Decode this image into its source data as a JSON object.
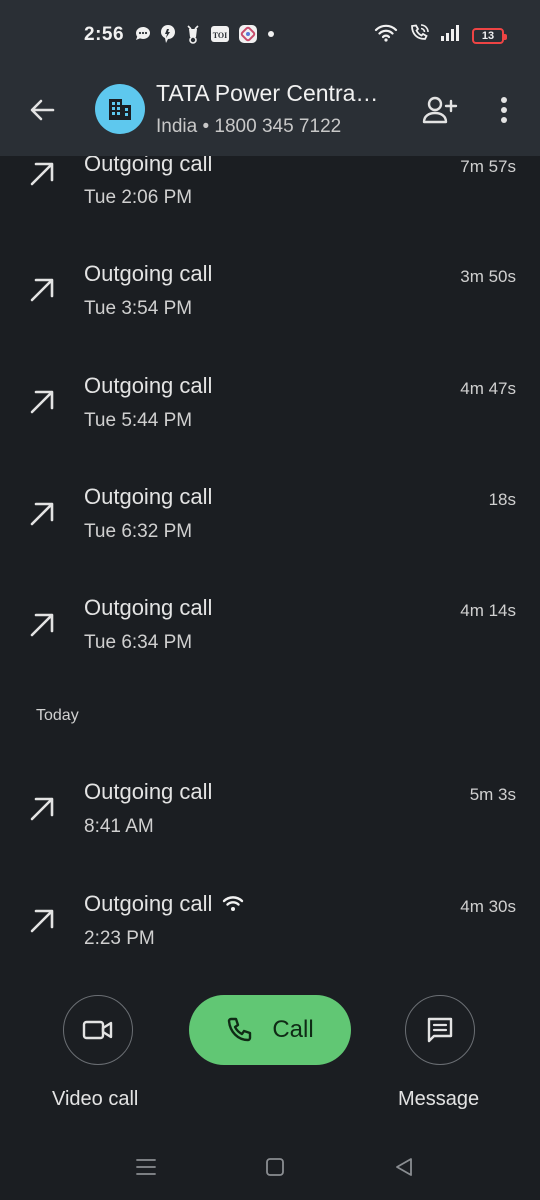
{
  "status_bar": {
    "time": "2:56",
    "notification_icons": [
      "chat-bubble-icon",
      "messenger-icon",
      "scooter-icon",
      "toi-icon",
      "app-icon",
      "dot-icon"
    ],
    "toi_label": "TOI",
    "battery_level": "13",
    "colors": {
      "battery_low": "#ee4444"
    }
  },
  "header": {
    "contact_name": "TATA Power Centra…",
    "contact_sub": "India • 1800 345 7122",
    "avatar_icon": "building-icon",
    "avatar_color": "#5ec8ee"
  },
  "calls": [
    {
      "type": "Outgoing call",
      "time": "Tue 2:06 PM",
      "duration": "7m 57s",
      "wifi": false
    },
    {
      "type": "Outgoing call",
      "time": "Tue 3:54 PM",
      "duration": "3m 50s",
      "wifi": false
    },
    {
      "type": "Outgoing call",
      "time": "Tue 5:44 PM",
      "duration": "4m 47s",
      "wifi": false
    },
    {
      "type": "Outgoing call",
      "time": "Tue 6:32 PM",
      "duration": "18s",
      "wifi": false
    },
    {
      "type": "Outgoing call",
      "time": "Tue 6:34 PM",
      "duration": "4m 14s",
      "wifi": false
    }
  ],
  "section_today": "Today",
  "calls_today": [
    {
      "type": "Outgoing call",
      "time": "8:41 AM",
      "duration": "5m 3s",
      "wifi": false
    },
    {
      "type": "Outgoing call",
      "time": "2:23 PM",
      "duration": "4m 30s",
      "wifi": true
    }
  ],
  "actions": {
    "video_label": "Video call",
    "call_label": "Call",
    "message_label": "Message",
    "call_color": "#61c774"
  }
}
